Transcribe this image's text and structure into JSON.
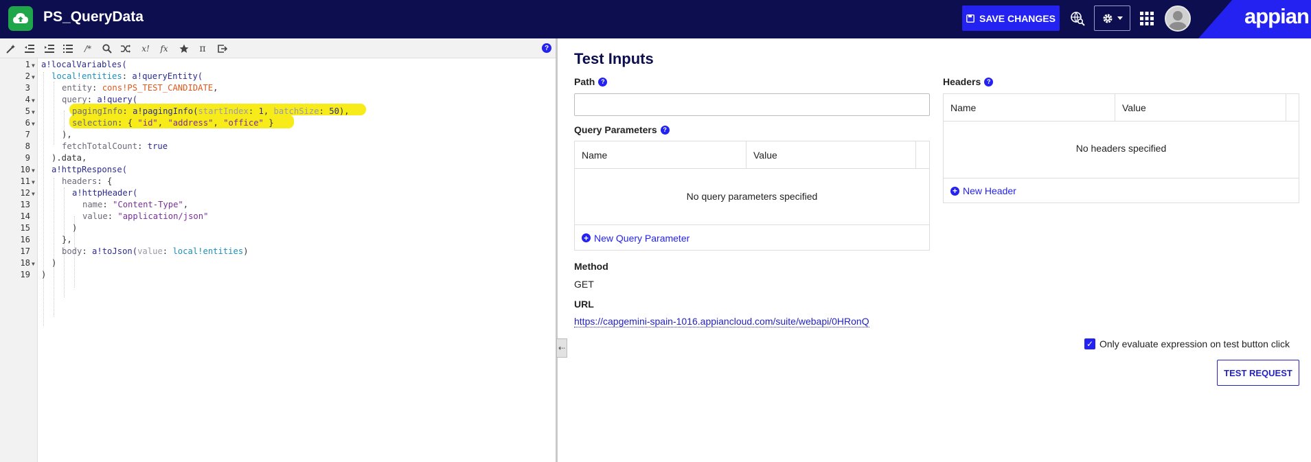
{
  "header": {
    "title": "PS_QueryData",
    "save_label": "SAVE CHANGES",
    "brand": "appian"
  },
  "editor": {
    "line_numbers": [
      "1",
      "2",
      "3",
      "4",
      "5",
      "6",
      "7",
      "8",
      "9",
      "10",
      "11",
      "12",
      "13",
      "14",
      "15",
      "16",
      "17",
      "18",
      "19"
    ],
    "lines": {
      "l1": [
        "a!localVariables("
      ],
      "l2": [
        "local!entities",
        ": ",
        "a!queryEntity("
      ],
      "l3": [
        "entity",
        ": ",
        "cons!PS_TEST_CANDIDATE",
        ","
      ],
      "l4": [
        "query",
        ": ",
        "a!query("
      ],
      "l5": [
        "pagingInfo",
        ": ",
        "a!pagingInfo(",
        "startIndex",
        ": ",
        "1",
        ", ",
        "batchSize",
        ": ",
        "50",
        "),"
      ],
      "l6": [
        "selection",
        ": { ",
        "\"id\"",
        ", ",
        "\"address\"",
        ", ",
        "\"office\"",
        " }"
      ],
      "l7": [
        "),"
      ],
      "l8": [
        "fetchTotalCount",
        ": ",
        "true"
      ],
      "l9": [
        ").data,"
      ],
      "l10": [
        "a!httpResponse("
      ],
      "l11": [
        "headers",
        ": {"
      ],
      "l12": [
        "a!httpHeader("
      ],
      "l13": [
        "name",
        ": ",
        "\"Content-Type\"",
        ","
      ],
      "l14": [
        "value",
        ": ",
        "\"application/json\""
      ],
      "l15": [
        ")"
      ],
      "l16": [
        "},"
      ],
      "l17": [
        "body",
        ": ",
        "a!toJson(",
        "value",
        ": ",
        "local!entities",
        ")"
      ],
      "l18": [
        ")"
      ],
      "l19": [
        ")"
      ]
    }
  },
  "panel": {
    "title": "Test Inputs",
    "path_label": "Path",
    "path_value": "",
    "query_params": {
      "label": "Query Parameters",
      "columns": [
        "Name",
        "Value"
      ],
      "empty": "No query parameters specified",
      "add": "New Query Parameter"
    },
    "headers": {
      "label": "Headers",
      "columns": [
        "Name",
        "Value"
      ],
      "empty": "No headers specified",
      "add": "New Header"
    },
    "method_label": "Method",
    "method_value": "GET",
    "url_label": "URL",
    "url_value": "https://capgemini-spain-1016.appiancloud.com/suite/webapi/0HRonQ",
    "checkbox_label": "Only evaluate expression on test button click",
    "checkbox_checked": true,
    "test_button": "TEST REQUEST"
  }
}
